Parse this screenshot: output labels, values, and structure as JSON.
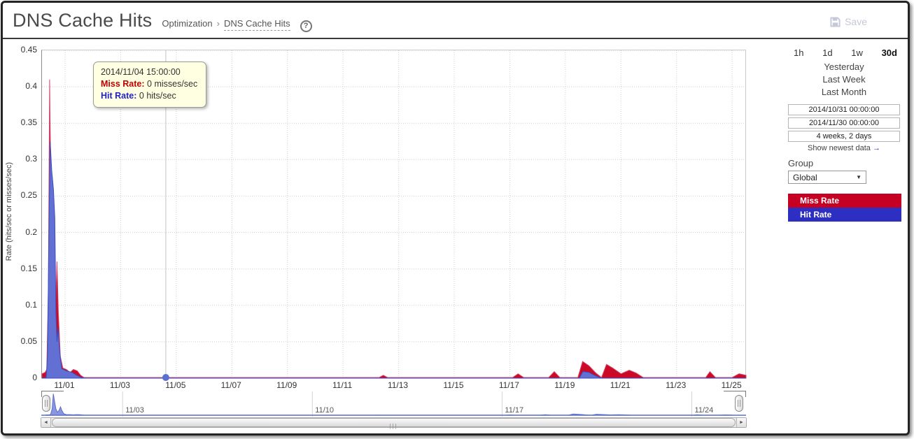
{
  "header": {
    "title": "DNS Cache Hits",
    "breadcrumb_parent": "Optimization",
    "breadcrumb_sep": "›",
    "breadcrumb_current": "DNS Cache Hits",
    "help_glyph": "?",
    "save_label": "Save"
  },
  "controls": {
    "ranges": [
      "1h",
      "1d",
      "1w",
      "30d"
    ],
    "active_range": "30d",
    "presets": [
      "Yesterday",
      "Last Week",
      "Last Month"
    ],
    "from_time": "2014/10/31 00:00:00",
    "to_time": "2014/11/30 00:00:00",
    "duration": "4 weeks, 2 days",
    "show_newest_label": "Show newest data",
    "show_newest_arrow": "→",
    "group_label": "Group",
    "group_value": "Global",
    "dropdown_glyph": "▼",
    "legend": [
      {
        "label": "Miss Rate",
        "color": "#c50023"
      },
      {
        "label": "Hit Rate",
        "color": "#2d2fc2"
      }
    ]
  },
  "tooltip": {
    "time": "2014/11/04 15:00:00",
    "miss_label": "Miss Rate:",
    "miss_value": "0 misses/sec",
    "hit_label": "Hit Rate:",
    "hit_value": "0 hits/sec"
  },
  "chart_data": {
    "type": "area",
    "title": "DNS Cache Hits",
    "ylabel": "Rate (hits/sec or misses/sec)",
    "legend_position": "right",
    "grid": true,
    "x_axis": {
      "min_day": 0.17,
      "max_day": 25.5,
      "origin_date": "2014/10/31",
      "ticks": [
        {
          "day": 1,
          "label": "11/01"
        },
        {
          "day": 3,
          "label": "11/03"
        },
        {
          "day": 5,
          "label": "11/05"
        },
        {
          "day": 7,
          "label": "11/07"
        },
        {
          "day": 9,
          "label": "11/09"
        },
        {
          "day": 11,
          "label": "11/11"
        },
        {
          "day": 13,
          "label": "11/13"
        },
        {
          "day": 15,
          "label": "11/15"
        },
        {
          "day": 17,
          "label": "11/17"
        },
        {
          "day": 19,
          "label": "11/19"
        },
        {
          "day": 21,
          "label": "11/21"
        },
        {
          "day": 23,
          "label": "11/23"
        },
        {
          "day": 25,
          "label": "11/25"
        }
      ]
    },
    "y_axis": {
      "min": 0,
      "max": 0.45,
      "ticks": [
        "0",
        "0.05",
        "0.1",
        "0.15",
        "0.2",
        "0.25",
        "0.3",
        "0.35",
        "0.4",
        "0.45"
      ]
    },
    "selection": {
      "day": 4.625,
      "time": "2014/11/04 15:00:00",
      "miss_rate": 0,
      "hit_rate": 0,
      "marker_color": "#5b6fd0"
    },
    "series": [
      {
        "name": "Miss Rate",
        "unit": "misses/sec",
        "fill": "#ca0a26",
        "stroke": "#d4486b",
        "points": [
          [
            0.17,
            0.006
          ],
          [
            0.28,
            0.008
          ],
          [
            0.34,
            0.012
          ],
          [
            0.4,
            0.12
          ],
          [
            0.445,
            0.41
          ],
          [
            0.49,
            0.26
          ],
          [
            0.54,
            0.12
          ],
          [
            0.6,
            0.055
          ],
          [
            0.66,
            0.1
          ],
          [
            0.71,
            0.16
          ],
          [
            0.76,
            0.09
          ],
          [
            0.83,
            0.03
          ],
          [
            0.92,
            0.014
          ],
          [
            1.05,
            0.012
          ],
          [
            1.18,
            0.008
          ],
          [
            1.3,
            0.012
          ],
          [
            1.44,
            0.01
          ],
          [
            1.56,
            0.004
          ],
          [
            1.68,
            0.001
          ],
          [
            3,
            0.001
          ],
          [
            6,
            0.001
          ],
          [
            9,
            0.001
          ],
          [
            12.3,
            0.001
          ],
          [
            12.45,
            0.004
          ],
          [
            12.6,
            0.001
          ],
          [
            15,
            0.001
          ],
          [
            17.1,
            0.001
          ],
          [
            17.3,
            0.006
          ],
          [
            17.5,
            0.001
          ],
          [
            18.4,
            0.001
          ],
          [
            18.6,
            0.009
          ],
          [
            18.8,
            0.001
          ],
          [
            19.45,
            0.001
          ],
          [
            19.62,
            0.023
          ],
          [
            19.85,
            0.017
          ],
          [
            20.1,
            0.007
          ],
          [
            20.3,
            0.001
          ],
          [
            20.48,
            0.019
          ],
          [
            20.7,
            0.014
          ],
          [
            21.0,
            0.006
          ],
          [
            21.3,
            0.011
          ],
          [
            21.55,
            0.007
          ],
          [
            21.8,
            0.001
          ],
          [
            23,
            0.001
          ],
          [
            24.05,
            0.001
          ],
          [
            24.2,
            0.009
          ],
          [
            24.4,
            0.001
          ],
          [
            25.0,
            0.001
          ],
          [
            25.25,
            0.006
          ],
          [
            25.5,
            0.004
          ]
        ]
      },
      {
        "name": "Hit Rate",
        "unit": "hits/sec",
        "fill": "#6170d2",
        "stroke": "#3b4dc0",
        "points": [
          [
            0.17,
            0
          ],
          [
            0.32,
            0.001
          ],
          [
            0.37,
            0.03
          ],
          [
            0.42,
            0.2
          ],
          [
            0.465,
            0.325
          ],
          [
            0.52,
            0.285
          ],
          [
            0.58,
            0.26
          ],
          [
            0.63,
            0.22
          ],
          [
            0.67,
            0.09
          ],
          [
            0.71,
            0.05
          ],
          [
            0.75,
            0.068
          ],
          [
            0.81,
            0.035
          ],
          [
            0.88,
            0.013
          ],
          [
            1.05,
            0.01
          ],
          [
            1.25,
            0.008
          ],
          [
            1.42,
            0.004
          ],
          [
            1.58,
            0.001
          ],
          [
            1.75,
            0
          ],
          [
            19.5,
            0
          ],
          [
            19.63,
            0.009
          ],
          [
            19.85,
            0.008
          ],
          [
            20.1,
            0.003
          ],
          [
            20.3,
            0
          ],
          [
            25.5,
            0
          ]
        ]
      }
    ]
  },
  "navigator": {
    "range_days": [
      0,
      26
    ],
    "labels": [
      {
        "day": 3,
        "label": "11/03"
      },
      {
        "day": 10,
        "label": "11/10"
      },
      {
        "day": 17,
        "label": "11/17"
      },
      {
        "day": 24,
        "label": "11/24"
      }
    ],
    "scroll": {
      "left_glyph": "◄",
      "right_glyph": "►",
      "grip_glyph": "|||"
    }
  }
}
